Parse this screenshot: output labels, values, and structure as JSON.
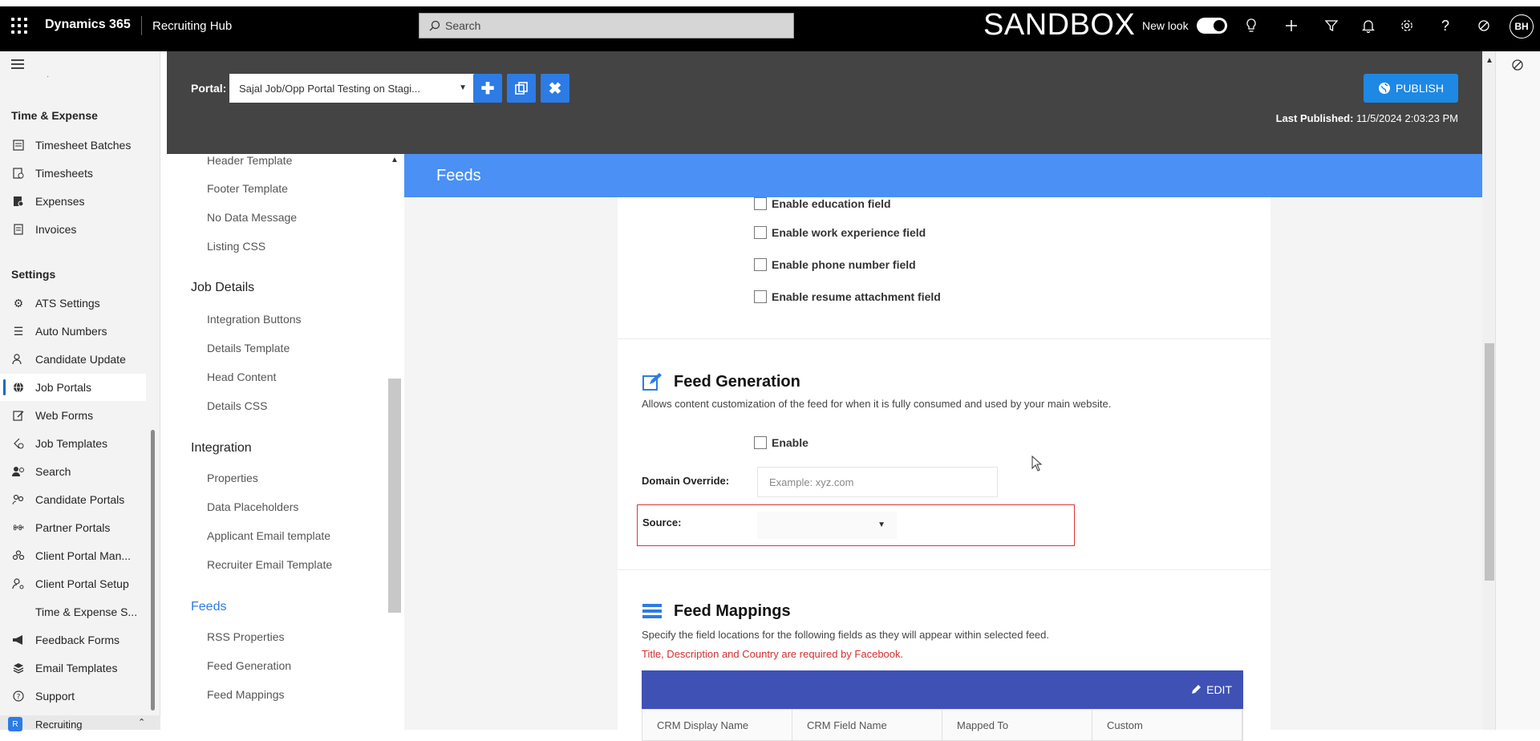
{
  "topbar": {
    "brand": "Dynamics 365",
    "app_name": "Recruiting Hub",
    "search_placeholder": "Search",
    "environment": "SANDBOX",
    "new_look_label": "New look",
    "avatar_initials": "BH"
  },
  "leftnav": {
    "dot": "·",
    "group_time": "Time & Expense",
    "items_time": [
      "Timesheet Batches",
      "Timesheets",
      "Expenses",
      "Invoices"
    ],
    "group_settings": "Settings",
    "items_settings": [
      "ATS Settings",
      "Auto Numbers",
      "Candidate Update",
      "Job Portals",
      "Web Forms",
      "Job Templates",
      "Search",
      "Candidate Portals",
      "Partner Portals",
      "Client Portal Man...",
      "Client Portal Setup",
      "Time & Expense S...",
      "Feedback Forms",
      "Email Templates",
      "Support"
    ],
    "area_switcher": "Recruiting",
    "area_badge": "R"
  },
  "portalbar": {
    "label": "Portal:",
    "selected": "Sajal Job/Opp Portal Testing on Stagi...",
    "publish_label": "PUBLISH",
    "last_published_label": "Last Published:",
    "last_published_value": "11/5/2024 2:03:23 PM"
  },
  "sidecol": {
    "links_top": [
      "Header Template",
      "Footer Template",
      "No Data Message",
      "Listing CSS"
    ],
    "head_job_details": "Job Details",
    "links_job_details": [
      "Integration Buttons",
      "Details Template",
      "Head Content",
      "Details CSS"
    ],
    "head_integration": "Integration",
    "links_integration": [
      "Properties",
      "Data Placeholders",
      "Applicant Email template",
      "Recruiter Email Template"
    ],
    "head_feeds": "Feeds",
    "links_feeds": [
      "RSS Properties",
      "Feed Generation",
      "Feed Mappings"
    ]
  },
  "main": {
    "section_title": "Feeds",
    "checkboxes": [
      "Enable education field",
      "Enable work experience field",
      "Enable phone number field",
      "Enable resume attachment field"
    ],
    "feed_generation": {
      "title": "Feed Generation",
      "description": "Allows content customization of the feed for when it is fully consumed and used by your main website.",
      "enable_label": "Enable",
      "domain_label": "Domain Override:",
      "domain_placeholder": "Example: xyz.com",
      "source_label": "Source:"
    },
    "feed_mappings": {
      "title": "Feed Mappings",
      "description": "Specify the field locations for the following fields as they will appear within selected feed.",
      "warning": "Title, Description and Country are required by Facebook.",
      "edit_label": "EDIT",
      "columns": [
        "CRM Display Name",
        "CRM Field Name",
        "Mapped To",
        "Custom"
      ]
    }
  },
  "colors": {
    "feeds_bar": "#4a90f5",
    "portal_bar": "#444444",
    "table_head": "#3f51b5",
    "warning": "#d32f2f",
    "highlight_border": "#d9343a"
  }
}
